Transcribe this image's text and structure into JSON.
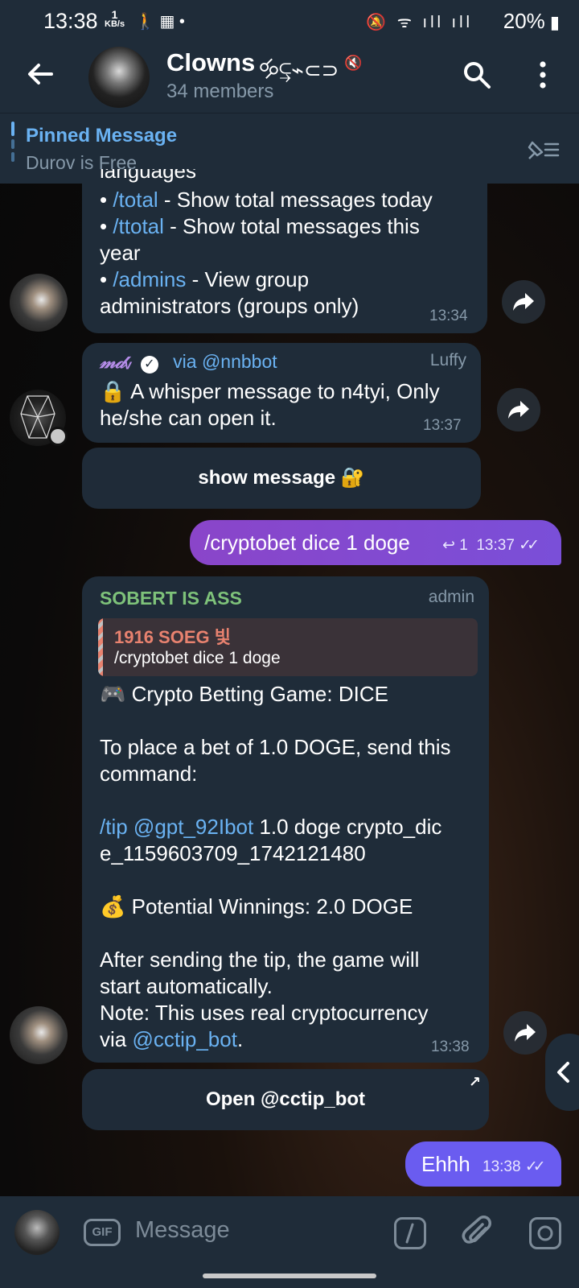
{
  "status": {
    "time": "13:38",
    "net_speed_top": "1",
    "net_speed_unit": "KB/s",
    "battery": "20%"
  },
  "header": {
    "title": "Clowns",
    "title_deco": "🝰⥹⌁⊂⊃",
    "members": "34 members"
  },
  "pinned": {
    "label": "Pinned Message",
    "text": "Durov is Free"
  },
  "msg1": {
    "lines": [
      {
        "bullet": "• ",
        "cmd": "/total",
        "rest": " - Show total messages today"
      },
      {
        "bullet": "• ",
        "cmd": "/ttotal",
        "rest": " - Show total messages this"
      },
      {
        "bullet": "",
        "cmd": "",
        "rest": "year"
      },
      {
        "bullet": "• ",
        "cmd": "/admins",
        "rest": " - View group"
      },
      {
        "bullet": "",
        "cmd": "",
        "rest": "administrators (groups only)"
      }
    ],
    "top_partial": "languages",
    "time": "13:34"
  },
  "msg2": {
    "sender": "𝓂𝒹ᵥ",
    "via": "via",
    "via_bot": "@nnbbot",
    "sender_name": "Luffy",
    "text_line1": "🔒 A whisper message to n4tyi, Only",
    "text_line2": "he/she can open it.",
    "time": "13:37",
    "button": "show message 🔐"
  },
  "out1": {
    "text": "/cryptobet dice 1 doge",
    "replies": "1",
    "time": "13:37"
  },
  "msg3": {
    "sender": "SOBERT IS ASS",
    "role": "admin",
    "reply_name": "1916 SOEG 빛",
    "reply_text": "/cryptobet dice 1 doge",
    "line_game": "🎮 Crypto Betting Game: DICE",
    "line_place1": "To place a bet of 1.0 DOGE, send this",
    "line_place2": "command:",
    "cmd_tip": "/tip",
    "cmd_bot": "@gpt_92Ibot",
    "cmd_rest": " 1.0 doge crypto_dic",
    "cmd_line2": "e_1159603709_1742121480",
    "line_win": "💰 Potential Winnings: 2.0 DOGE",
    "line_after1": "After sending the tip, the game will",
    "line_after2": "start automatically.",
    "line_note1": "Note: This uses real cryptocurrency",
    "line_note2_pre": "via ",
    "line_note2_link": "@cctip_bot",
    "line_note2_post": ".",
    "time": "13:38",
    "button": "Open @cctip_bot"
  },
  "out2": {
    "text": "Ehhh",
    "time": "13:38"
  },
  "input": {
    "gif": "GIF",
    "placeholder": "Message"
  },
  "colors": {
    "bar": "#1f2c39",
    "bubble_in": "#1f2c39",
    "bubble_out": "#7b4fd6",
    "bubble_out2": "#6a5cf0",
    "link": "#6ab2f2",
    "sender_green": "#7ec27a",
    "reply_red": "#e8826f"
  }
}
